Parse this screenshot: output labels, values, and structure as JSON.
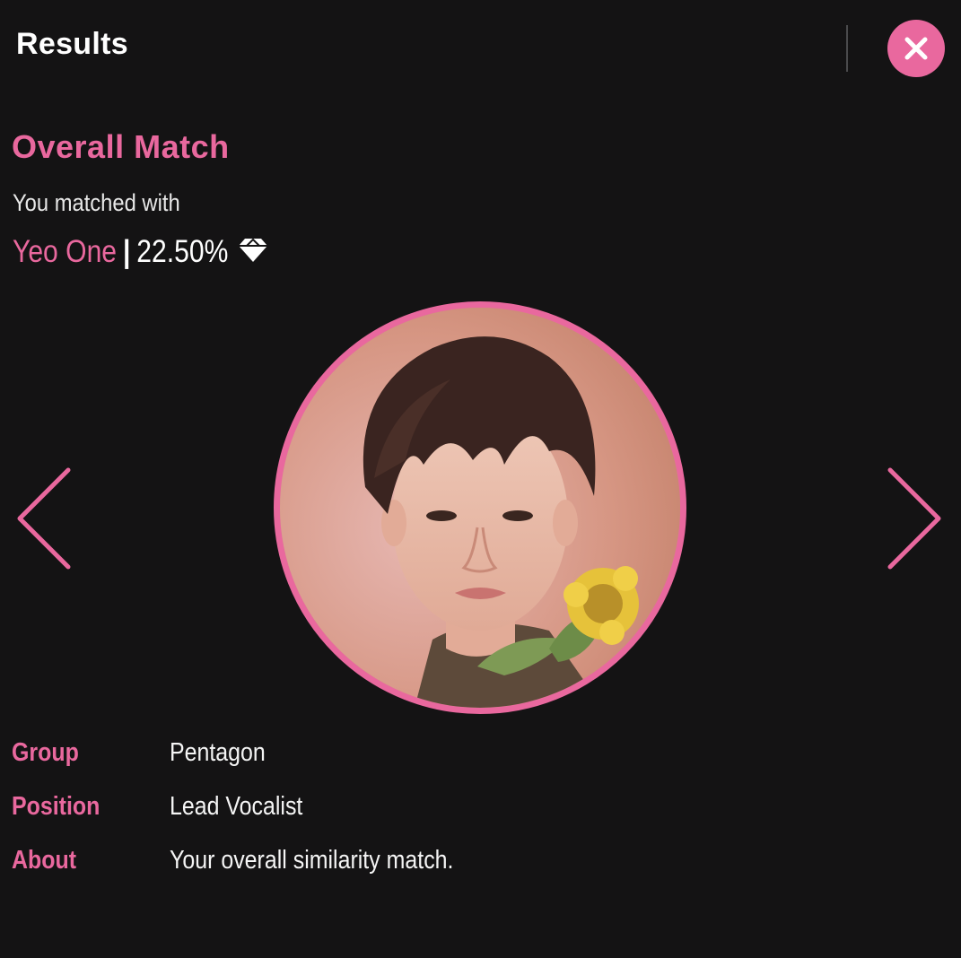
{
  "header": {
    "title": "Results",
    "close_icon": "close-icon"
  },
  "match": {
    "heading": "Overall Match",
    "intro": "You matched with",
    "name": "Yeo One",
    "separator": "|",
    "percent": "22.50%",
    "badge_icon": "diamond-icon"
  },
  "carousel": {
    "prev_icon": "chevron-left-icon",
    "next_icon": "chevron-right-icon"
  },
  "details": [
    {
      "label": "Group",
      "value": "Pentagon"
    },
    {
      "label": "Position",
      "value": "Lead Vocalist"
    },
    {
      "label": "About",
      "value": "Your overall similarity match."
    }
  ],
  "colors": {
    "accent": "#e9689e",
    "background": "#141314",
    "text": "#f2f2f2"
  }
}
